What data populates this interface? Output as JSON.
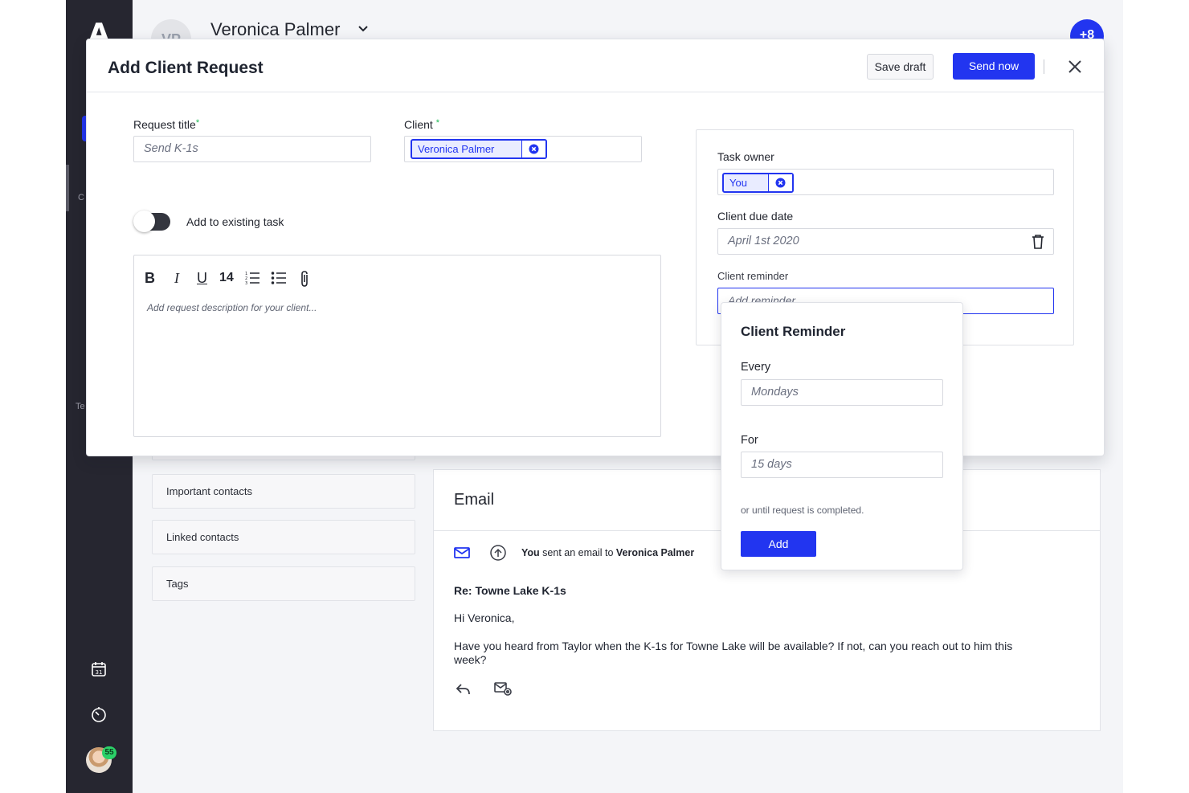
{
  "app": {
    "logo_letter": "A",
    "rail_partial_labels": [
      "C",
      "Te"
    ],
    "notification_count": "55",
    "header": {
      "avatar_initials": "VP",
      "contact_name": "Veronica Palmer",
      "plus_label": "+8"
    }
  },
  "side_panels": [
    "Important contacts",
    "Linked contacts",
    "Tags"
  ],
  "email": {
    "heading": "Email",
    "sent_by": "You",
    "sent_text": "sent an email to",
    "recipient": "Veronica Palmer",
    "subject": "Re: Towne Lake K-1s",
    "greeting": "Hi Veronica,",
    "body": "Have you heard from Taylor when the K-1s for Towne Lake will be available? If not, can you reach out to him this week?"
  },
  "modal": {
    "title": "Add Client Request",
    "save_draft_label": "Save draft",
    "send_now_label": "Send now",
    "request_title_label": "Request title",
    "request_title_placeholder": "Send K-1s",
    "client_label": "Client",
    "required_mark": "*",
    "client_chip": "Veronica Palmer",
    "toggle_label": "Add to existing task",
    "toolbar": {
      "bold": "B",
      "italic": "I",
      "underline": "U",
      "font_size": "14"
    },
    "description_placeholder": "Add request description for your client...",
    "task_owner_label": "Task owner",
    "task_owner_chip": "You",
    "due_date_label": "Client due date",
    "due_date_value": "April 1st 2020",
    "reminder_label": "Client reminder",
    "reminder_placeholder": "Add reminder"
  },
  "reminder_popover": {
    "title": "Client Reminder",
    "every_label": "Every",
    "every_value": "Mondays",
    "for_label": "For",
    "for_value": "15 days",
    "note": "or until request is completed.",
    "add_label": "Add"
  },
  "colors": {
    "accent": "#2235f0",
    "rail": "#262630",
    "required": "#1db954",
    "badge": "#2bd168"
  }
}
